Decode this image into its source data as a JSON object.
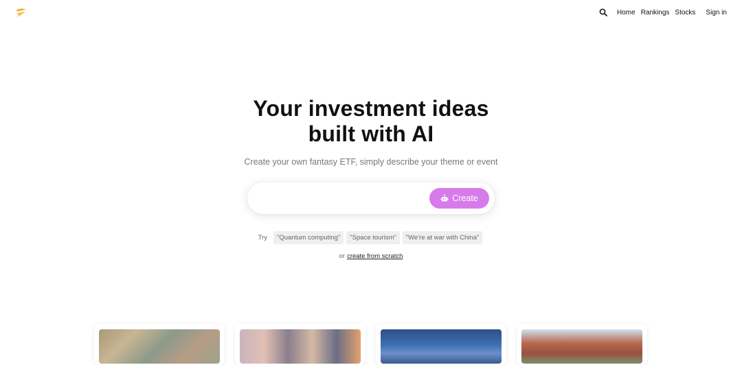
{
  "nav": {
    "links": [
      "Home",
      "Rankings",
      "Stocks"
    ],
    "signin": "Sign in"
  },
  "hero": {
    "title_line1": "Your investment ideas",
    "title_line2": "built with AI",
    "subtitle": "Create your own fantasy ETF, simply describe your theme or event"
  },
  "search": {
    "value": "",
    "placeholder": "",
    "button_label": "Create"
  },
  "suggestions": {
    "label": "Try",
    "chips": [
      "\"Quantum computing\"",
      "\"Space tourism\"",
      "\"We're at war with China\""
    ]
  },
  "scratch": {
    "prefix": "or",
    "link": "create from scratch"
  },
  "colors": {
    "accent": "#d67be9",
    "logo": "#f2b738"
  },
  "icons": [
    "logo-icon",
    "search-icon",
    "robot-icon"
  ]
}
